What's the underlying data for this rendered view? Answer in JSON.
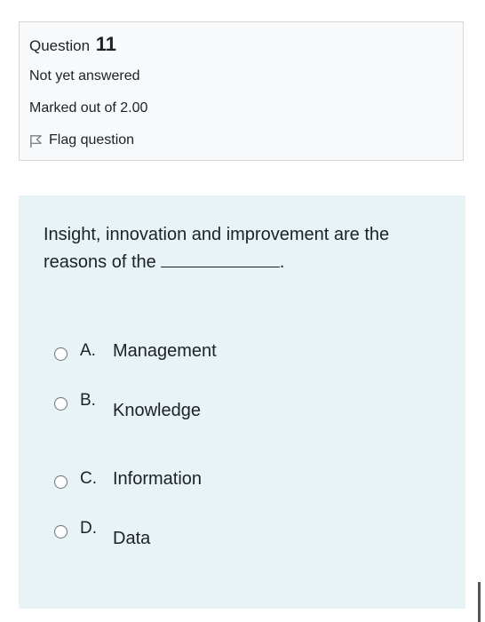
{
  "question_info": {
    "heading_label": "Question",
    "number": "11",
    "state": "Not yet answered",
    "grade": "Marked out of 2.00",
    "flag_label": "Flag question",
    "flag_icon": "flag-outline-icon"
  },
  "question": {
    "text_part1": "Insight, innovation and improvement are the reasons of the",
    "text_part2": "."
  },
  "answers": [
    {
      "letter": "A.",
      "label": "Management",
      "selected": false
    },
    {
      "letter": "B.",
      "label": "Knowledge",
      "selected": false
    },
    {
      "letter": "C.",
      "label": "Information",
      "selected": false
    },
    {
      "letter": "D.",
      "label": "Data",
      "selected": false
    }
  ],
  "colors": {
    "info_background": "#f8f9fa",
    "content_background": "#e7f3f5",
    "text": "#1d2125",
    "border": "#d7d7d7"
  }
}
